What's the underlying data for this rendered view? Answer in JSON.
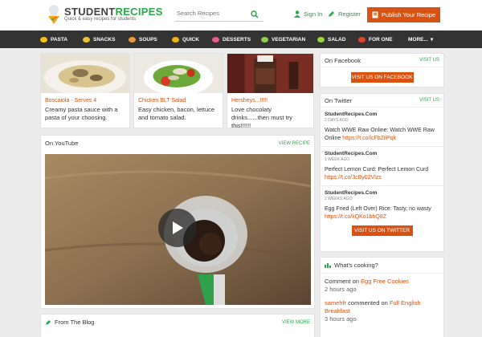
{
  "header": {
    "logo_student": "STUDENT",
    "logo_recipes": "RECIPES",
    "tagline": "Quick & easy recipes for students",
    "search_placeholder": "Search Recipes",
    "sign_in": "Sign In",
    "register": "Register",
    "publish": "Publish Your Recipe"
  },
  "nav": {
    "items": [
      {
        "label": "PASTA",
        "color": "#f3c21a"
      },
      {
        "label": "SNACKS",
        "color": "#f0c030"
      },
      {
        "label": "SOUPS",
        "color": "#e89a3c"
      },
      {
        "label": "QUICK",
        "color": "#f2b312"
      },
      {
        "label": "DESSERTS",
        "color": "#e85a8a"
      },
      {
        "label": "VEGETARIAN",
        "color": "#8fcf4a"
      },
      {
        "label": "SALAD",
        "color": "#9dd43b"
      },
      {
        "label": "FOR ONE",
        "color": "#e0452b"
      }
    ],
    "more": "MORE..."
  },
  "recipes": [
    {
      "title": "Boscaiola - Serves 4",
      "desc": "Creamy pasta sauce with a pasta of your choosing."
    },
    {
      "title": "Chicken BLT Salad",
      "desc": "Easy chicken, bacon, lettuce and tomato salad."
    },
    {
      "title": "Hersheys...!!!!!",
      "desc": "Love chocolaty drinks......then must try this!!!!!!"
    }
  ],
  "youtube": {
    "title": "On YouTube",
    "action": "VIEW RECIPE"
  },
  "blog": {
    "title": "From The Blog",
    "action": "VIEW MORE"
  },
  "facebook": {
    "title": "On Facebook",
    "action": "VISIT US",
    "button": "VISIT US ON FACEBOOK"
  },
  "twitter": {
    "title": "On Twitter",
    "action": "VISIT US",
    "button": "VISIT US ON TWITTER",
    "tweets": [
      {
        "user": "StudentRecipes.Com",
        "time": "2 DAYS AGO",
        "text": "Watch WWE Raw Online: Watch WWE Raw Online ",
        "link": "https://t.co/lcFbZiiPqk"
      },
      {
        "user": "StudentRecipes.Com",
        "time": "1 WEEK AGO",
        "text": "Perfect Lemon Curd: Perfect Lemon Curd ",
        "link": "https://t.co/3cBy02Vlzs"
      },
      {
        "user": "StudentRecipes.Com",
        "time": "2 WEEKS AGO",
        "text": "Egg Fried (Left Over) Rice: Tasty, no wasty ",
        "link": "https://t.co/kQKo1bhQ8Z"
      }
    ]
  },
  "cooking": {
    "title": "What's cooking?",
    "items": [
      {
        "user": "Comment",
        "verb": " on ",
        "target": "Egg Free Cookies",
        "time": "2 hours ago"
      },
      {
        "user": "samehfr",
        "verb": " commented on ",
        "target": "Full English Breakfast",
        "time": "3 hours ago"
      }
    ]
  }
}
